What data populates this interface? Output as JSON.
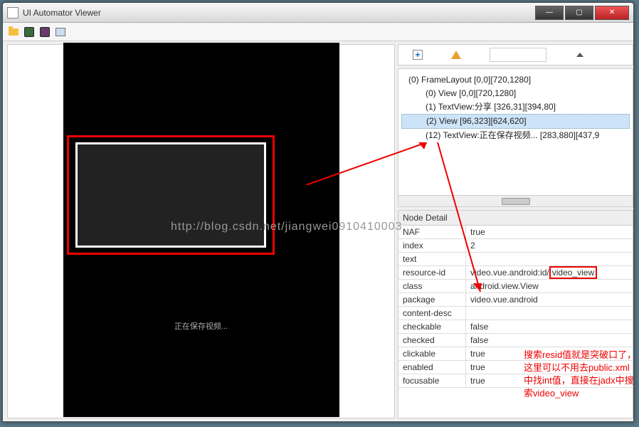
{
  "window": {
    "title": "UI Automator Viewer"
  },
  "phone": {
    "saving_text": "正在保存视频...",
    "watermark": "http://blog.csdn.net/jiangwei0910410003"
  },
  "tree": {
    "nodes": [
      {
        "indent": 0,
        "label": "(0) FrameLayout [0,0][720,1280]"
      },
      {
        "indent": 1,
        "label": "(0) View [0,0][720,1280]"
      },
      {
        "indent": 1,
        "label": "(1) TextView:分享 [326,31][394,80]"
      },
      {
        "indent": 1,
        "label": "(2) View [96,323][624,620]",
        "selected": true
      },
      {
        "indent": 1,
        "label": "(12) TextView:正在保存视频... [283,880][437,9"
      }
    ]
  },
  "detail": {
    "header": "Node Detail",
    "rows": [
      {
        "key": "NAF",
        "val": "true"
      },
      {
        "key": "index",
        "val": "2"
      },
      {
        "key": "text",
        "val": ""
      },
      {
        "key": "resource-id",
        "val_prefix": "video.vue.android:id/",
        "val_boxed": "video_view"
      },
      {
        "key": "class",
        "val": "android.view.View"
      },
      {
        "key": "package",
        "val": "video.vue.android"
      },
      {
        "key": "content-desc",
        "val": ""
      },
      {
        "key": "checkable",
        "val": "false"
      },
      {
        "key": "checked",
        "val": "false"
      },
      {
        "key": "clickable",
        "val": "true"
      },
      {
        "key": "enabled",
        "val": "true"
      },
      {
        "key": "focusable",
        "val": "true"
      }
    ]
  },
  "annotation": {
    "text": "搜索resid值就是突破口了，这里可以不用去public.xml中找int值，直接在jadx中搜索video_view"
  }
}
